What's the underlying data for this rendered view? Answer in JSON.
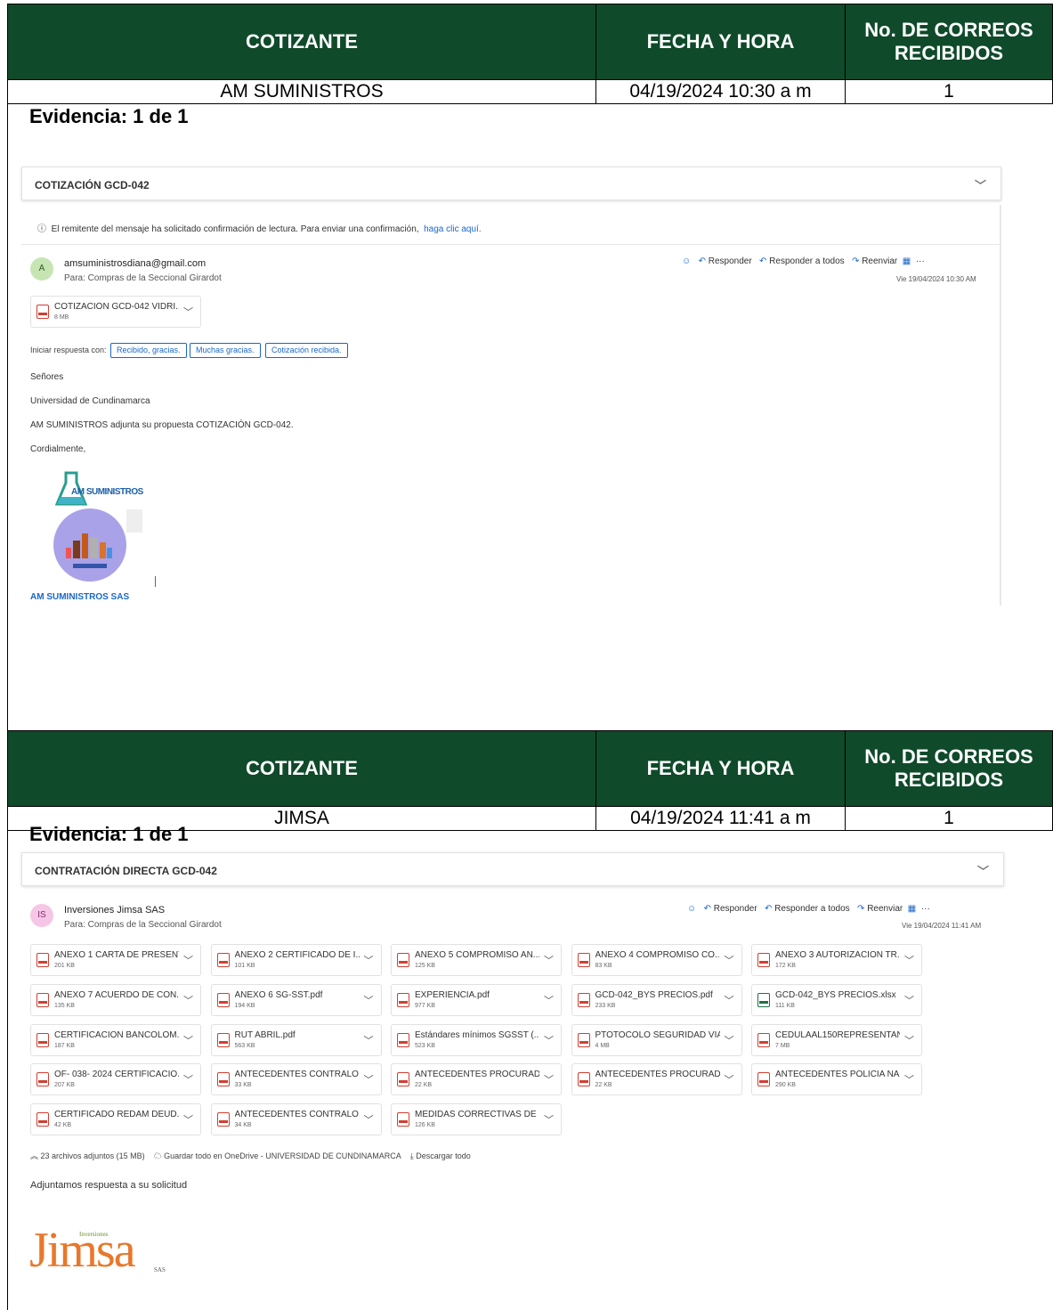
{
  "headers": {
    "cotizante": "COTIZANTE",
    "fecha": "FECHA Y HORA",
    "correos": "No. DE CORREOS RECIBIDOS"
  },
  "block1": {
    "cotizante": "AM SUMINISTROS",
    "fecha": "04/19/2024  10:30 a m",
    "correos": "1",
    "evidencia": "Evidencia: 1 de 1",
    "email": {
      "subject": "COTIZACIÓN GCD-042",
      "notice": "El remitente del mensaje ha solicitado confirmación de lectura. Para enviar una confirmación,",
      "notice_link": "haga clic aquí.",
      "avatar": "A",
      "sender": "amsuministrosdiana@gmail.com",
      "to": "Para:  Compras de la Seccional Girardot",
      "actions": {
        "reply": "Responder",
        "reply_all": "Responder a todos",
        "forward": "Reenviar",
        "more": "···"
      },
      "date": "Vie 19/04/2024 10:30 AM",
      "attachment": {
        "name": "COTIZACIÓN GCD-042 VIDRI...",
        "size": "8 MB"
      },
      "quick_reply_label": "Iniciar respuesta con:",
      "quick_replies": [
        "Recibido, gracias.",
        "Muchas gracias.",
        "Cotización recibida."
      ],
      "body": [
        "Señores",
        "Universidad de Cundinamarca",
        "AM SUMINISTROS adjunta su propuesta COTIZACIÓN GCD-042.",
        "Cordialmente,"
      ],
      "logo_text": "AM SUMINISTROS",
      "signature": "AM SUMINISTROS SAS"
    }
  },
  "block2": {
    "cotizante": "JIMSA",
    "fecha": "04/19/2024  11:41 a m",
    "correos": "1",
    "evidencia": "Evidencia: 1 de 1",
    "email": {
      "subject": "CONTRATACIÓN DIRECTA GCD-042",
      "avatar": "IS",
      "sender": "Inversiones Jimsa SAS",
      "to": "Para:  Compras de la Seccional Girardot",
      "actions": {
        "reply": "Responder",
        "reply_all": "Responder a todos",
        "forward": "Reenviar",
        "more": "···"
      },
      "date": "Vie 19/04/2024 11:41 AM",
      "attachments": [
        {
          "name": "ANEXO 1 CARTA DE PRESENT...",
          "size": "201 KB",
          "type": "pdf"
        },
        {
          "name": "ANEXO 2 CERTIFICADO DE I...",
          "size": "101 KB",
          "type": "pdf"
        },
        {
          "name": "ANEXO 5 COMPROMISO AN...",
          "size": "125 KB",
          "type": "pdf"
        },
        {
          "name": "ANEXO 4 COMPROMISO CO...",
          "size": "83 KB",
          "type": "pdf"
        },
        {
          "name": "ANEXO 3 AUTORIZACION TR...",
          "size": "172 KB",
          "type": "pdf"
        },
        {
          "name": "ANEXO 7 ACUERDO DE CON...",
          "size": "135 KB",
          "type": "pdf"
        },
        {
          "name": "ANEXO 6 SG-SST.pdf",
          "size": "194 KB",
          "type": "pdf"
        },
        {
          "name": "EXPERIENCIA.pdf",
          "size": "977 KB",
          "type": "pdf"
        },
        {
          "name": "GCD-042_BYS PRECIOS.pdf",
          "size": "233 KB",
          "type": "pdf"
        },
        {
          "name": "GCD-042_BYS PRECIOS.xlsx",
          "size": "111 KB",
          "type": "xlsx"
        },
        {
          "name": "CERTIFICACION BANCOLOM...",
          "size": "187 KB",
          "type": "pdf"
        },
        {
          "name": "RUT ABRIL.pdf",
          "size": "563 KB",
          "type": "pdf"
        },
        {
          "name": "Estándares mínimos SGSST (...",
          "size": "523 KB",
          "type": "pdf"
        },
        {
          "name": "PTOTOCOLO SEGURIDAD VIA...",
          "size": "4 MB",
          "type": "pdf"
        },
        {
          "name": "CEDULAAL150REPRESENTAN...",
          "size": "7 MB",
          "type": "pdf"
        },
        {
          "name": "OF- 038- 2024 CERTIFICACIO...",
          "size": "207 KB",
          "type": "pdf"
        },
        {
          "name": "ANTECEDENTES CONTRALO...",
          "size": "33 KB",
          "type": "pdf"
        },
        {
          "name": "ANTECEDENTES PROCURAD...",
          "size": "22 KB",
          "type": "pdf"
        },
        {
          "name": "ANTECEDENTES PROCURAD...",
          "size": "22 KB",
          "type": "pdf"
        },
        {
          "name": "ANTECEDENTES POLICIA NA...",
          "size": "290 KB",
          "type": "pdf"
        },
        {
          "name": "CERTIFICADO REDAM DEUD...",
          "size": "42 KB",
          "type": "pdf"
        },
        {
          "name": "ANTECEDENTES CONTRALO...",
          "size": "34 KB",
          "type": "pdf"
        },
        {
          "name": "MEDIDAS CORRECTIVAS DE ...",
          "size": "126 KB",
          "type": "pdf"
        }
      ],
      "attach_summary": "23 archivos adjuntos (15 MB)",
      "save_onedrive": "Guardar todo en OneDrive - UNIVERSIDAD DE CUNDINAMARCA",
      "download_all": "Descargar todo",
      "body": "Adjuntamos respuesta a su solicitud",
      "logo_text": "Jimsa",
      "logo_small": "Inversiones",
      "logo_sas": "SAS"
    }
  },
  "colors": {
    "header_bg": "#0f4a2a",
    "link": "#1a67c9",
    "pdf": "#d23f31",
    "xlsx": "#1e7145"
  }
}
